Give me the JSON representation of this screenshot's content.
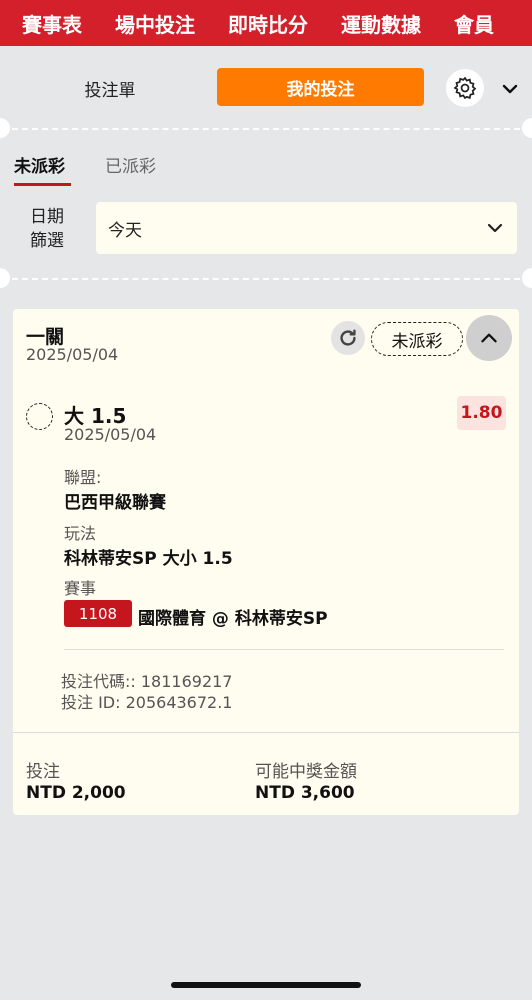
{
  "nav": {
    "items": [
      "賽事表",
      "場中投注",
      "即時比分",
      "運動數據",
      "會員"
    ]
  },
  "betslip_tabs": {
    "betslip": "投注單",
    "my_bets": "我的投注"
  },
  "sub_tabs": {
    "unsettled": "未派彩",
    "settled": "已派彩"
  },
  "filter": {
    "label": "日期篩選",
    "label_line1": "日期",
    "label_line2": "篩選",
    "value": "今天"
  },
  "bet_card": {
    "type": "一關",
    "date": "2025/05/04",
    "status": "未派彩",
    "selection": {
      "name": "大 1.5",
      "date": "2025/05/04",
      "odds": "1.80",
      "league_label": "聯盟:",
      "league": "巴西甲級聯賽",
      "market_label": "玩法",
      "market": "科林蒂安SP 大小 1.5",
      "event_label": "賽事",
      "event_id": "1108",
      "event_name": "國際體育 @ 科林蒂安SP"
    },
    "bet_code": "投注代碼:: 181169217",
    "bet_id": "投注 ID: 205643672.1",
    "stake_label": "投注",
    "stake": "NTD 2,000",
    "payout_label": "可能中獎金額",
    "payout": "NTD 3,600"
  },
  "colors": {
    "brand_red": "#d3202a",
    "accent_orange": "#ff7a00",
    "odds_red": "#c4161c"
  }
}
